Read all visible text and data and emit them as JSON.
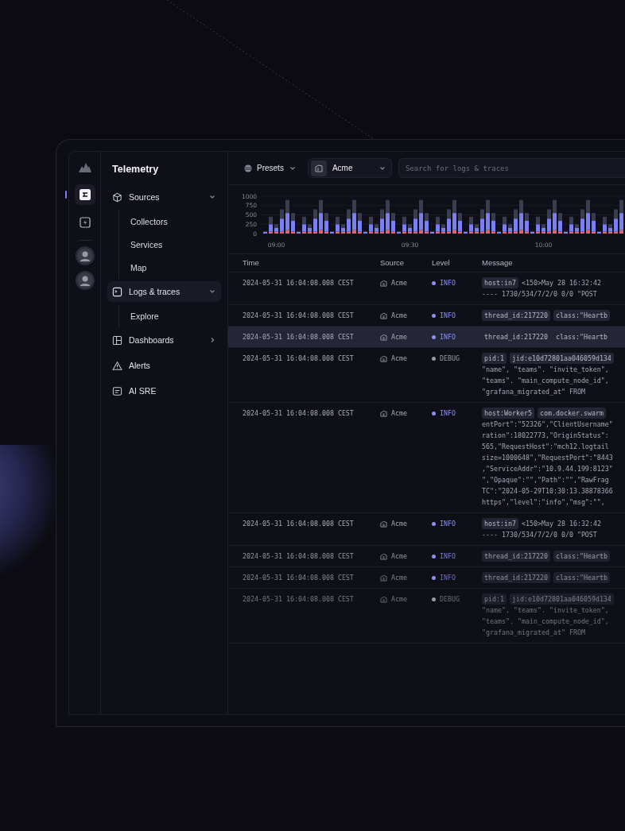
{
  "app": {
    "title": "Telemetry"
  },
  "rail": {
    "items": [
      {
        "selected": true
      },
      {
        "selected": false
      }
    ]
  },
  "nav": [
    {
      "label": "Sources",
      "expanded": true,
      "selected": false,
      "children": [
        {
          "label": "Collectors"
        },
        {
          "label": "Services"
        },
        {
          "label": "Map"
        }
      ]
    },
    {
      "label": "Logs & traces",
      "expanded": true,
      "selected": true,
      "children": [
        {
          "label": "Explore"
        }
      ]
    },
    {
      "label": "Dashboards",
      "expanded": false,
      "selected": false
    },
    {
      "label": "Alerts",
      "selected": false
    },
    {
      "label": "AI SRE",
      "selected": false
    }
  ],
  "toolbar": {
    "presets": "Presets",
    "source": "Acme",
    "search": {
      "placeholder": "Search for logs & traces"
    }
  },
  "chart_data": {
    "type": "bar",
    "stacked": true,
    "categories": [
      null,
      null,
      "09:00",
      null,
      null,
      null,
      null,
      null,
      null,
      null,
      null,
      null,
      null,
      null,
      null,
      null,
      null,
      null,
      null,
      null,
      null,
      null,
      null,
      null,
      null,
      null,
      "09:30",
      null,
      null,
      null,
      null,
      null,
      null,
      null,
      null,
      null,
      null,
      null,
      null,
      null,
      null,
      null,
      null,
      null,
      null,
      null,
      null,
      null,
      null,
      null,
      "10:00",
      null,
      null,
      null,
      null,
      null,
      null,
      null,
      null,
      null,
      null,
      null,
      null,
      null,
      null
    ],
    "series": [
      {
        "color": "#e0646e",
        "values": [
          0,
          50,
          50,
          50,
          100,
          50,
          0,
          50,
          50,
          50,
          100,
          50,
          0,
          50,
          50,
          50,
          100,
          50,
          0,
          50,
          50,
          50,
          100,
          50,
          0,
          50,
          50,
          50,
          100,
          50,
          0,
          50,
          50,
          50,
          100,
          50,
          0,
          50,
          50,
          50,
          100,
          50,
          0,
          50,
          50,
          50,
          100,
          50,
          0,
          50,
          50,
          50,
          100,
          50,
          0,
          50,
          50,
          50,
          100,
          50,
          0,
          50,
          50,
          50,
          100
        ]
      },
      {
        "color": "#7c7ff2",
        "values": [
          50,
          200,
          100,
          350,
          450,
          300,
          50,
          200,
          100,
          350,
          450,
          300,
          50,
          200,
          100,
          350,
          450,
          300,
          50,
          200,
          100,
          350,
          450,
          300,
          50,
          200,
          100,
          350,
          450,
          300,
          50,
          200,
          100,
          350,
          450,
          300,
          50,
          200,
          100,
          350,
          450,
          300,
          50,
          200,
          100,
          350,
          450,
          300,
          50,
          200,
          100,
          350,
          450,
          300,
          50,
          200,
          100,
          350,
          450,
          300,
          50,
          200,
          100,
          350,
          450
        ]
      },
      {
        "color": "#3a3d4f",
        "values": [
          0,
          200,
          100,
          250,
          350,
          200,
          0,
          200,
          100,
          250,
          350,
          200,
          0,
          200,
          100,
          250,
          350,
          200,
          0,
          200,
          100,
          250,
          350,
          200,
          0,
          200,
          100,
          250,
          350,
          200,
          0,
          200,
          100,
          250,
          350,
          200,
          0,
          200,
          100,
          250,
          350,
          200,
          0,
          200,
          100,
          250,
          350,
          200,
          0,
          200,
          100,
          250,
          350,
          200,
          0,
          200,
          100,
          250,
          350,
          200,
          0,
          200,
          100,
          250,
          350
        ]
      }
    ],
    "ylim": [
      0,
      1000
    ],
    "yticks": [
      0,
      250,
      500,
      750,
      1000
    ],
    "grid": true
  },
  "table": {
    "columns": [
      "Time",
      "Source",
      "Level",
      "Message"
    ],
    "rows": [
      {
        "time": "2024-05-31 16:04:08.008 CEST",
        "source": "Acme",
        "severity": "INFO",
        "color": "#8b8ef7",
        "selected": false,
        "tags": [
          "host:in7"
        ],
        "text": "<150>May 28 16:32:42",
        "lines": [
          "---- 1730/534/7/2/0 0/0 \"POST"
        ]
      },
      {
        "time": "2024-05-31 16:04:08.008 CEST",
        "source": "Acme",
        "severity": "INFO",
        "color": "#8b8ef7",
        "selected": false,
        "tags": [
          "thread_id:217220",
          "class:\"Heartb"
        ]
      },
      {
        "time": "2024-05-31 16:04:08.008 CEST",
        "source": "Acme",
        "severity": "INFO",
        "color": "#8b8ef7",
        "selected": true,
        "tags": [
          "thread_id:217220",
          "class:\"Heartb"
        ]
      },
      {
        "time": "2024-05-31 16:04:08.008 CEST",
        "source": "Acme",
        "severity": "DEBUG",
        "color": "#9a9aa6",
        "selected": false,
        "tags": [
          "pid:1",
          "jid:e10d72801aa046059d134"
        ],
        "lines": [
          "\"name\", \"teams\". \"invite_token\",",
          "\"teams\". \"main_compute_node_id\",",
          "\"grafana_migrated_at\" FROM"
        ]
      },
      {
        "time": "2024-05-31 16:04:08.008 CEST",
        "source": "Acme",
        "severity": "INFO",
        "color": "#8b8ef7",
        "selected": false,
        "tags": [
          "host:Worker5",
          "com.docker.swarm"
        ],
        "lines": [
          "entPort\":\"52326\",\"ClientUsername\"",
          "ration\":18022773,\"OriginStatus\":",
          "565,\"RequestHost\":\"mch12.logtail",
          "size=1000648\",\"RequestPort\":\"8443",
          ",\"ServiceAddr\":\"10.9.44.199:8123\"",
          "\",\"Opaque\":\"\",\"Path\":\"\",\"RawFrag",
          "TC\":\"2024-05-29T10:30:13.38878366",
          "https\",\"level\":\"info\",\"msg\":\"\","
        ]
      },
      {
        "time": "2024-05-31 16:04:08.008 CEST",
        "source": "Acme",
        "severity": "INFO",
        "color": "#8b8ef7",
        "selected": false,
        "tags": [
          "host:in7"
        ],
        "text": "<150>May 28 16:32:42",
        "lines": [
          "---- 1730/534/7/2/0 0/0 \"POST"
        ]
      },
      {
        "time": "2024-05-31 16:04:08.008 CEST",
        "source": "Acme",
        "severity": "INFO",
        "color": "#8b8ef7",
        "selected": false,
        "tags": [
          "thread_id:217220",
          "class:\"Heartb"
        ]
      },
      {
        "time": "2024-05-31 16:04:08.008 CEST",
        "source": "Acme",
        "severity": "INFO",
        "color": "#8b8ef7",
        "selected": false,
        "tags": [
          "thread_id:217220",
          "class:\"Heartb"
        ]
      },
      {
        "time": "2024-05-31 16:04:08.008 CEST",
        "source": "Acme",
        "severity": "DEBUG",
        "color": "#9a9aa6",
        "selected": false,
        "tags": [
          "pid:1",
          "jid:e10d72801aa046059d134"
        ],
        "lines": [
          "\"name\", \"teams\". \"invite_token\",",
          "\"teams\". \"main_compute_node_id\",",
          "\"grafana_migrated_at\" FROM"
        ]
      }
    ]
  }
}
